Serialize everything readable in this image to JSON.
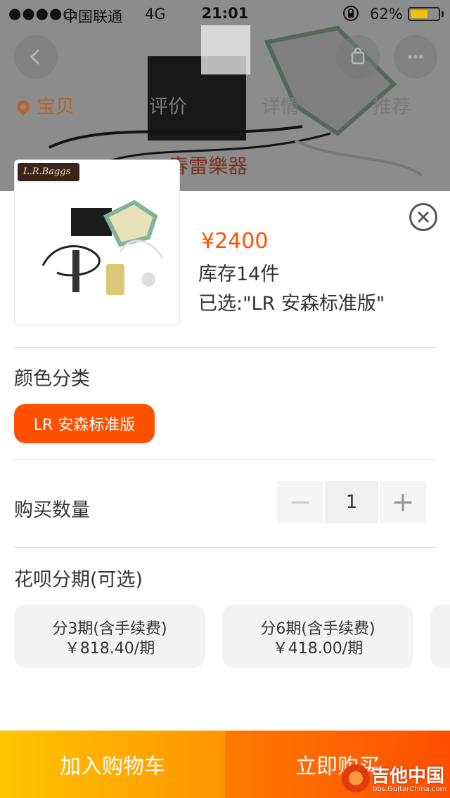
{
  "status_bar": {
    "signal": "●●●●○",
    "carrier": "中国联通",
    "network": "4G",
    "time": "21:01",
    "orientation_lock_icon": "lock-rotation-icon",
    "battery_percent": "62%",
    "battery_level": 0.62,
    "battery_color": "#f5c000"
  },
  "nav": {
    "back_icon": "chevron-left-icon",
    "cart_icon": "cart-icon",
    "more_icon": "more-icon"
  },
  "tabs": [
    {
      "label": "宝贝",
      "active": true
    },
    {
      "label": "评价",
      "active": false
    },
    {
      "label": "详情",
      "active": false
    },
    {
      "label": "推荐",
      "active": false
    }
  ],
  "background_watermark": "春雷樂器",
  "product": {
    "brand_tag": "L.R.Baggs",
    "price": "¥2400",
    "stock": "库存14件",
    "selected": "已选:\"LR 安森标准版\"",
    "close_icon": "close-icon"
  },
  "color_section": {
    "title": "颜色分类",
    "options": [
      {
        "label": "LR 安森标准版",
        "selected": true
      }
    ]
  },
  "quantity": {
    "title": "购买数量",
    "minus": "−",
    "value": "1",
    "plus": "+"
  },
  "installment": {
    "title": "花呗分期(可选)",
    "options": [
      {
        "line1": "分3期(含手续费)",
        "line2": "￥818.40/期"
      },
      {
        "line1": "分6期(含手续费)",
        "line2": "￥418.00/期"
      }
    ]
  },
  "actions": {
    "add_to_cart": "加入购物车",
    "buy_now": "立即购买"
  },
  "watermark": {
    "title": "吉他中国",
    "subtitle": "bbs.GuitarChina.com"
  },
  "colors": {
    "accent": "#ff5000",
    "cart_button_from": "#ffc500",
    "cart_button_to": "#ff9402",
    "buy_button_from": "#ff7a00",
    "buy_button_to": "#ff4f00"
  }
}
